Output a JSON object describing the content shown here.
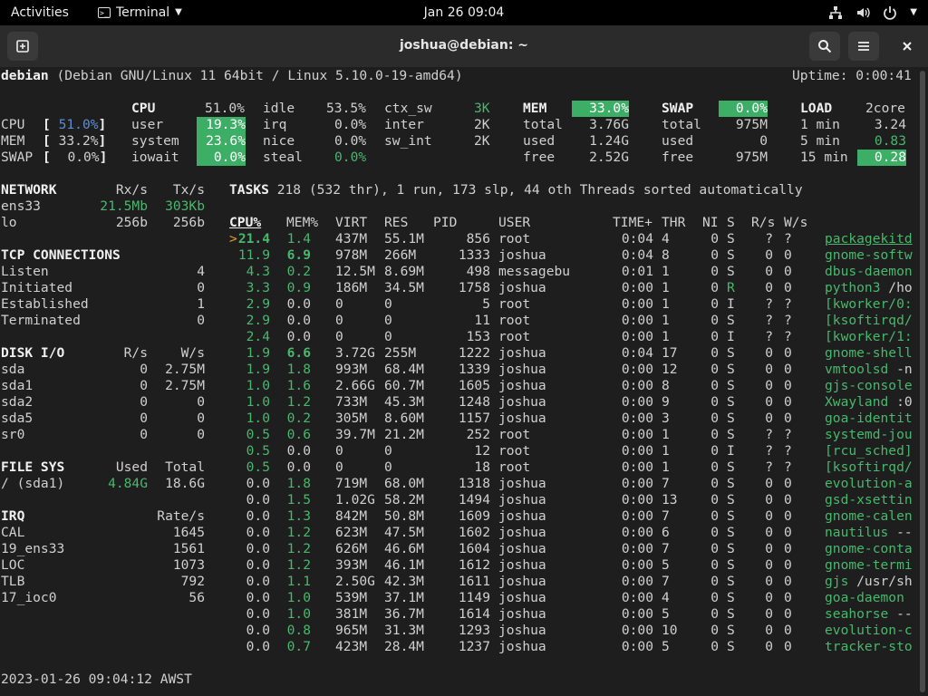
{
  "topbar": {
    "activities": "Activities",
    "app_name": "Terminal",
    "clock": "Jan 26  09:04",
    "tray_icons": [
      "network-icon",
      "volume-icon",
      "power-icon",
      "chevron-down-icon"
    ]
  },
  "window": {
    "title": "joshua@debian: ~",
    "buttons": [
      "new-tab-icon",
      "search-icon",
      "hamburger-menu-icon",
      "close-icon"
    ]
  },
  "glances": {
    "host": "debian",
    "os": "(Debian GNU/Linux 11 64bit / Linux 5.10.0-19-amd64)",
    "uptime": "Uptime: 0:00:41",
    "quicklook": [
      {
        "label": "CPU",
        "value": "51.0%"
      },
      {
        "label": "MEM",
        "value": "33.2%"
      },
      {
        "label": "SWAP",
        "value": "0.0%"
      }
    ],
    "cpu": {
      "header": "CPU",
      "total": "51.0%",
      "user": "19.3%",
      "system": "23.6%",
      "iowait": "0.0%",
      "idle": "53.5%",
      "irq": "0.0%",
      "nice": "0.0%",
      "steal": "0.0%",
      "ctx_sw": "3K",
      "inter": "2K",
      "sw_int": "2K"
    },
    "mem": {
      "header": "MEM",
      "percent": "33.0%",
      "total": "3.76G",
      "used": "1.24G",
      "free": "2.52G"
    },
    "swap": {
      "header": "SWAP",
      "percent": "0.0%",
      "total": "975M",
      "used": "0",
      "free": "975M"
    },
    "load": {
      "header": "LOAD",
      "cores": "2core",
      "min1": "3.24",
      "min5": "0.83",
      "min15": "0.28"
    },
    "network": {
      "header": "NETWORK",
      "rx": "Rx/s",
      "tx": "Tx/s",
      "rows": [
        {
          "name": "ens33",
          "rx": "21.5Mb",
          "tx": "303Kb"
        },
        {
          "name": "lo",
          "rx": "256b",
          "tx": "256b"
        }
      ]
    },
    "tcp": {
      "header": "TCP CONNECTIONS",
      "rows": [
        {
          "name": "Listen",
          "value": "4"
        },
        {
          "name": "Initiated",
          "value": "0"
        },
        {
          "name": "Established",
          "value": "1"
        },
        {
          "name": "Terminated",
          "value": "0"
        }
      ]
    },
    "disk": {
      "header": "DISK I/O",
      "r": "R/s",
      "w": "W/s",
      "rows": [
        {
          "name": "sda",
          "r": "0",
          "w": "2.75M"
        },
        {
          "name": "sda1",
          "r": "0",
          "w": "2.75M"
        },
        {
          "name": "sda2",
          "r": "0",
          "w": "0"
        },
        {
          "name": "sda5",
          "r": "0",
          "w": "0"
        },
        {
          "name": "sr0",
          "r": "0",
          "w": "0"
        }
      ]
    },
    "fs": {
      "header": "FILE SYS",
      "used": "Used",
      "total": "Total",
      "rows": [
        {
          "name": "/ (sda1)",
          "used": "4.84G",
          "total": "18.6G"
        }
      ]
    },
    "irq": {
      "header": "IRQ",
      "rate": "Rate/s",
      "rows": [
        {
          "name": "CAL",
          "value": "1645"
        },
        {
          "name": "19_ens33",
          "value": "1561"
        },
        {
          "name": "LOC",
          "value": "1073"
        },
        {
          "name": "TLB",
          "value": "792"
        },
        {
          "name": "17_ioc0",
          "value": "56"
        }
      ]
    },
    "tasks": {
      "label": "TASKS",
      "summary": "218 (532 thr), 1 run, 173 slp, 44 oth Threads sorted automatically"
    },
    "process_columns": [
      "CPU%",
      "MEM%",
      "VIRT",
      "RES",
      "PID",
      "USER",
      "TIME+",
      "THR",
      "NI",
      "S",
      "R/s",
      "W/s"
    ],
    "processes": [
      {
        "cpu": "21.4",
        "mem": "1.4",
        "virt": "437M",
        "res": "55.1M",
        "pid": "856",
        "user": "root",
        "time": "0:04",
        "thr": "4",
        "ni": "0",
        "s": "S",
        "rs": "?",
        "ws": "?",
        "cmd": "packagekitd",
        "arg": ""
      },
      {
        "cpu": "11.9",
        "mem": "6.9",
        "virt": "978M",
        "res": "266M",
        "pid": "1333",
        "user": "joshua",
        "time": "0:04",
        "thr": "8",
        "ni": "0",
        "s": "S",
        "rs": "0",
        "ws": "0",
        "cmd": "gnome-softw",
        "arg": ""
      },
      {
        "cpu": "4.3",
        "mem": "0.2",
        "virt": "12.5M",
        "res": "8.69M",
        "pid": "498",
        "user": "messagebu",
        "time": "0:01",
        "thr": "1",
        "ni": "0",
        "s": "S",
        "rs": "0",
        "ws": "0",
        "cmd": "dbus-daemon",
        "arg": ""
      },
      {
        "cpu": "3.3",
        "mem": "0.9",
        "virt": "186M",
        "res": "34.5M",
        "pid": "1758",
        "user": "joshua",
        "time": "0:00",
        "thr": "1",
        "ni": "0",
        "s": "R",
        "rs": "0",
        "ws": "0",
        "cmd": "python3",
        "arg": " /ho"
      },
      {
        "cpu": "2.9",
        "mem": "0.0",
        "virt": "0",
        "res": "0",
        "pid": "5",
        "user": "root",
        "time": "0:00",
        "thr": "1",
        "ni": "0",
        "s": "I",
        "rs": "?",
        "ws": "?",
        "cmd": "[kworker/0:",
        "arg": ""
      },
      {
        "cpu": "2.9",
        "mem": "0.0",
        "virt": "0",
        "res": "0",
        "pid": "11",
        "user": "root",
        "time": "0:00",
        "thr": "1",
        "ni": "0",
        "s": "S",
        "rs": "?",
        "ws": "?",
        "cmd": "[ksoftirqd/",
        "arg": ""
      },
      {
        "cpu": "2.4",
        "mem": "0.0",
        "virt": "0",
        "res": "0",
        "pid": "153",
        "user": "root",
        "time": "0:00",
        "thr": "1",
        "ni": "0",
        "s": "I",
        "rs": "?",
        "ws": "?",
        "cmd": "[kworker/1:",
        "arg": ""
      },
      {
        "cpu": "1.9",
        "mem": "6.6",
        "virt": "3.72G",
        "res": "255M",
        "pid": "1222",
        "user": "joshua",
        "time": "0:04",
        "thr": "17",
        "ni": "0",
        "s": "S",
        "rs": "0",
        "ws": "0",
        "cmd": "gnome-shell",
        "arg": ""
      },
      {
        "cpu": "1.9",
        "mem": "1.8",
        "virt": "993M",
        "res": "68.4M",
        "pid": "1339",
        "user": "joshua",
        "time": "0:00",
        "thr": "12",
        "ni": "0",
        "s": "S",
        "rs": "0",
        "ws": "0",
        "cmd": "vmtoolsd",
        "arg": " -n"
      },
      {
        "cpu": "1.0",
        "mem": "1.6",
        "virt": "2.66G",
        "res": "60.7M",
        "pid": "1605",
        "user": "joshua",
        "time": "0:00",
        "thr": "8",
        "ni": "0",
        "s": "S",
        "rs": "0",
        "ws": "0",
        "cmd": "gjs-console",
        "arg": ""
      },
      {
        "cpu": "1.0",
        "mem": "1.2",
        "virt": "733M",
        "res": "45.3M",
        "pid": "1248",
        "user": "joshua",
        "time": "0:00",
        "thr": "9",
        "ni": "0",
        "s": "S",
        "rs": "0",
        "ws": "0",
        "cmd": "Xwayland",
        "arg": " :0"
      },
      {
        "cpu": "1.0",
        "mem": "0.2",
        "virt": "305M",
        "res": "8.60M",
        "pid": "1157",
        "user": "joshua",
        "time": "0:00",
        "thr": "3",
        "ni": "0",
        "s": "S",
        "rs": "0",
        "ws": "0",
        "cmd": "goa-identit",
        "arg": ""
      },
      {
        "cpu": "0.5",
        "mem": "0.6",
        "virt": "39.7M",
        "res": "21.2M",
        "pid": "252",
        "user": "root",
        "time": "0:00",
        "thr": "1",
        "ni": "0",
        "s": "S",
        "rs": "?",
        "ws": "?",
        "cmd": "systemd-jou",
        "arg": ""
      },
      {
        "cpu": "0.5",
        "mem": "0.0",
        "virt": "0",
        "res": "0",
        "pid": "12",
        "user": "root",
        "time": "0:00",
        "thr": "1",
        "ni": "0",
        "s": "I",
        "rs": "?",
        "ws": "?",
        "cmd": "[rcu_sched]",
        "arg": ""
      },
      {
        "cpu": "0.5",
        "mem": "0.0",
        "virt": "0",
        "res": "0",
        "pid": "18",
        "user": "root",
        "time": "0:00",
        "thr": "1",
        "ni": "0",
        "s": "S",
        "rs": "?",
        "ws": "?",
        "cmd": "[ksoftirqd/",
        "arg": ""
      },
      {
        "cpu": "0.0",
        "mem": "1.8",
        "virt": "719M",
        "res": "68.0M",
        "pid": "1318",
        "user": "joshua",
        "time": "0:00",
        "thr": "7",
        "ni": "0",
        "s": "S",
        "rs": "0",
        "ws": "0",
        "cmd": "evolution-a",
        "arg": ""
      },
      {
        "cpu": "0.0",
        "mem": "1.5",
        "virt": "1.02G",
        "res": "58.2M",
        "pid": "1494",
        "user": "joshua",
        "time": "0:00",
        "thr": "13",
        "ni": "0",
        "s": "S",
        "rs": "0",
        "ws": "0",
        "cmd": "gsd-xsettin",
        "arg": ""
      },
      {
        "cpu": "0.0",
        "mem": "1.3",
        "virt": "842M",
        "res": "50.8M",
        "pid": "1609",
        "user": "joshua",
        "time": "0:00",
        "thr": "7",
        "ni": "0",
        "s": "S",
        "rs": "0",
        "ws": "0",
        "cmd": "gnome-calen",
        "arg": ""
      },
      {
        "cpu": "0.0",
        "mem": "1.2",
        "virt": "623M",
        "res": "47.5M",
        "pid": "1602",
        "user": "joshua",
        "time": "0:00",
        "thr": "6",
        "ni": "0",
        "s": "S",
        "rs": "0",
        "ws": "0",
        "cmd": "nautilus",
        "arg": " --"
      },
      {
        "cpu": "0.0",
        "mem": "1.2",
        "virt": "626M",
        "res": "46.6M",
        "pid": "1604",
        "user": "joshua",
        "time": "0:00",
        "thr": "7",
        "ni": "0",
        "s": "S",
        "rs": "0",
        "ws": "0",
        "cmd": "gnome-conta",
        "arg": ""
      },
      {
        "cpu": "0.0",
        "mem": "1.2",
        "virt": "393M",
        "res": "46.1M",
        "pid": "1612",
        "user": "joshua",
        "time": "0:00",
        "thr": "5",
        "ni": "0",
        "s": "S",
        "rs": "0",
        "ws": "0",
        "cmd": "gnome-termi",
        "arg": ""
      },
      {
        "cpu": "0.0",
        "mem": "1.1",
        "virt": "2.50G",
        "res": "42.3M",
        "pid": "1611",
        "user": "joshua",
        "time": "0:00",
        "thr": "7",
        "ni": "0",
        "s": "S",
        "rs": "0",
        "ws": "0",
        "cmd": "gjs",
        "arg": " /usr/sh"
      },
      {
        "cpu": "0.0",
        "mem": "1.0",
        "virt": "539M",
        "res": "37.1M",
        "pid": "1149",
        "user": "joshua",
        "time": "0:00",
        "thr": "4",
        "ni": "0",
        "s": "S",
        "rs": "0",
        "ws": "0",
        "cmd": "goa-daemon",
        "arg": ""
      },
      {
        "cpu": "0.0",
        "mem": "1.0",
        "virt": "381M",
        "res": "36.7M",
        "pid": "1614",
        "user": "joshua",
        "time": "0:00",
        "thr": "5",
        "ni": "0",
        "s": "S",
        "rs": "0",
        "ws": "0",
        "cmd": "seahorse",
        "arg": " --"
      },
      {
        "cpu": "0.0",
        "mem": "0.8",
        "virt": "965M",
        "res": "31.3M",
        "pid": "1293",
        "user": "joshua",
        "time": "0:00",
        "thr": "10",
        "ni": "0",
        "s": "S",
        "rs": "0",
        "ws": "0",
        "cmd": "evolution-c",
        "arg": ""
      },
      {
        "cpu": "0.0",
        "mem": "0.7",
        "virt": "423M",
        "res": "28.4M",
        "pid": "1237",
        "user": "joshua",
        "time": "0:00",
        "thr": "5",
        "ni": "0",
        "s": "S",
        "rs": "0",
        "ws": "0",
        "cmd": "tracker-sto",
        "arg": ""
      }
    ],
    "footer": "2023-01-26 09:04:12 AWST"
  },
  "colors": {
    "accent_green": "#3dae66",
    "text_green": "#48b86c",
    "blue": "#5b8fd6",
    "background": "#1e1e1e"
  }
}
